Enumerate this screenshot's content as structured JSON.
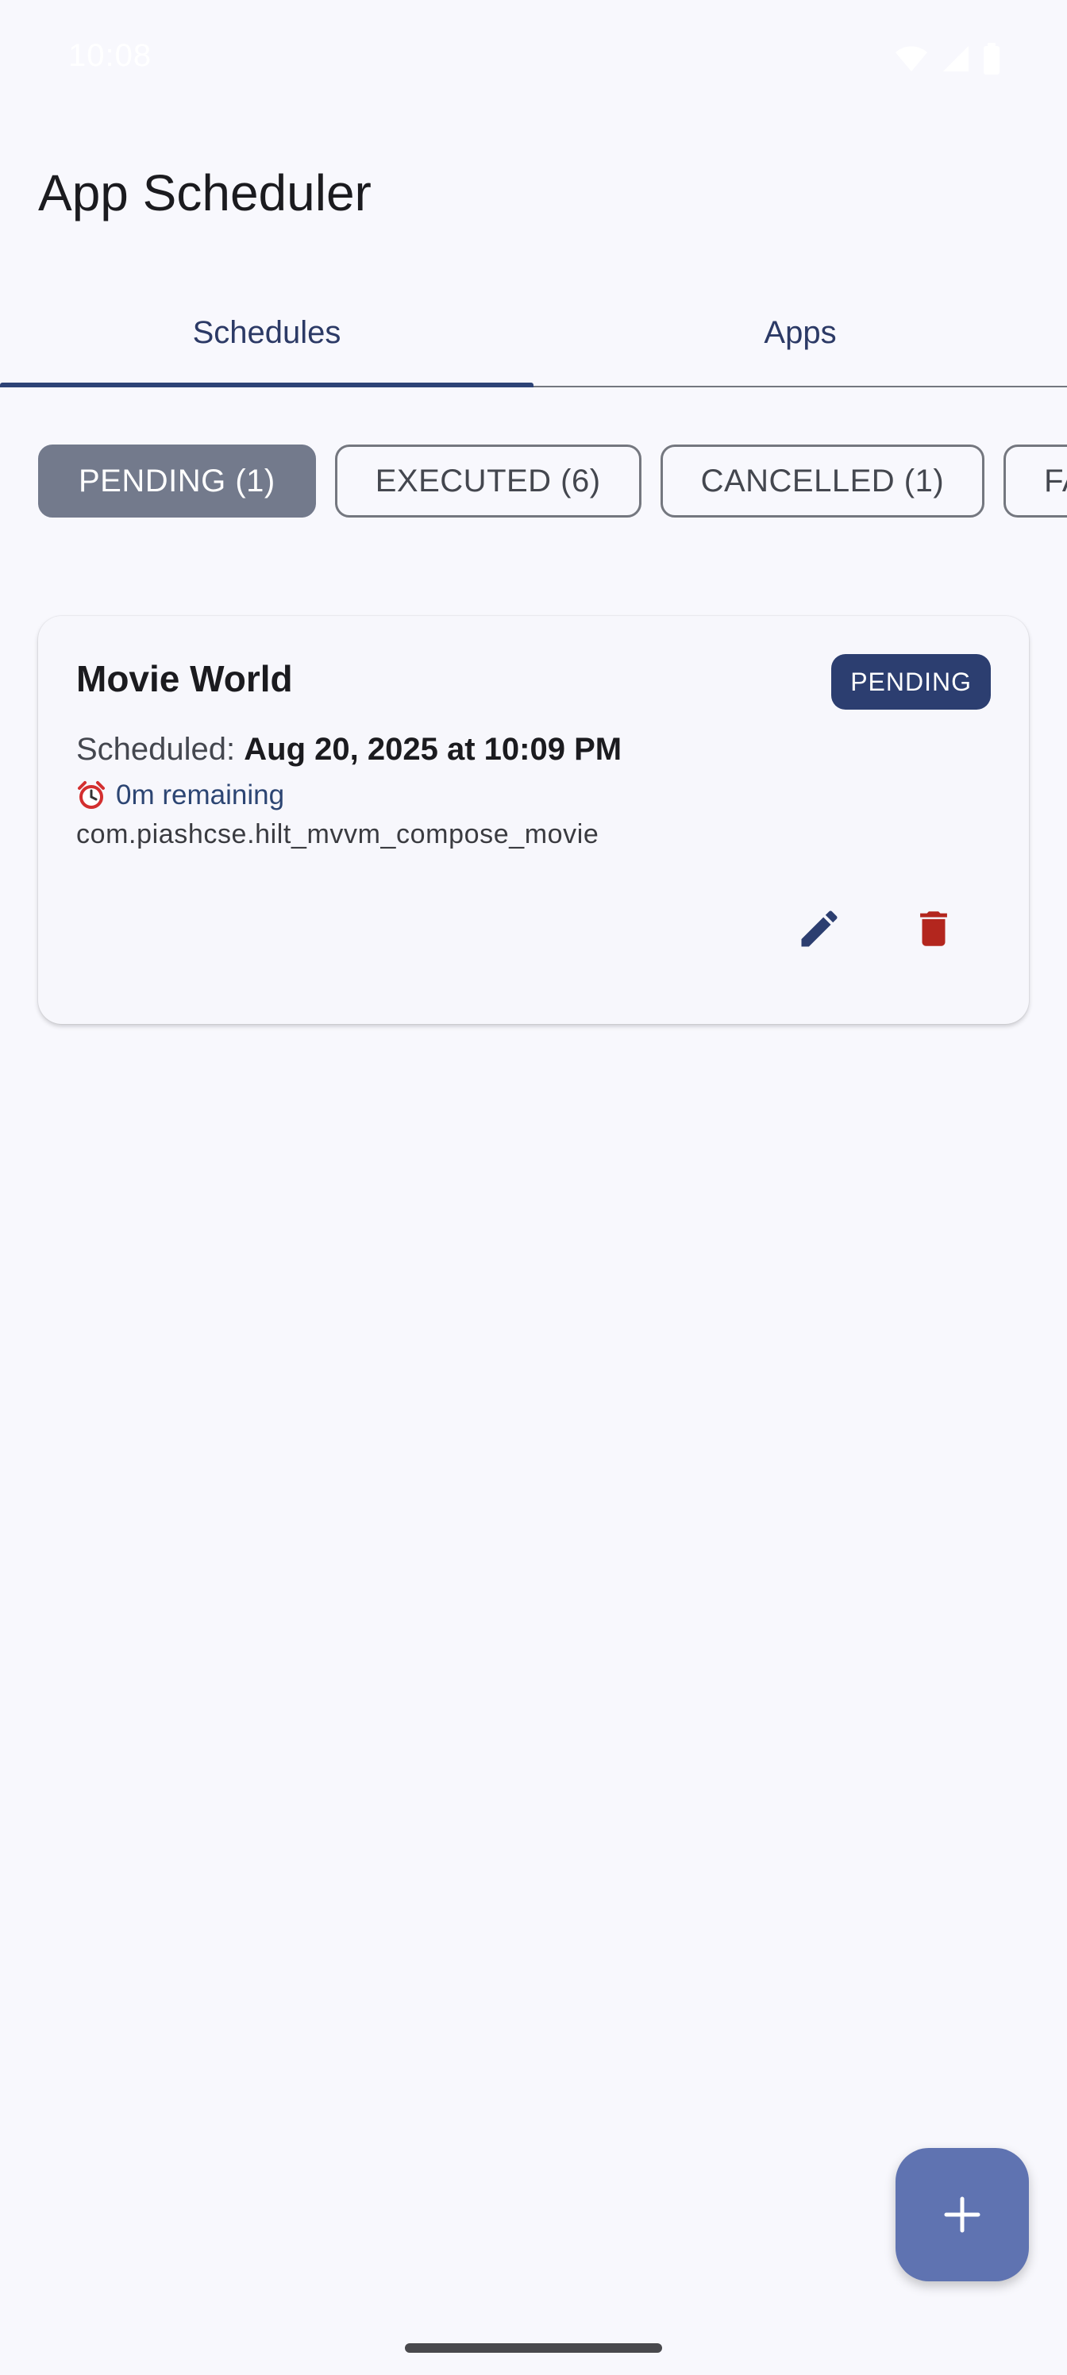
{
  "status_bar": {
    "time": "10:08",
    "icons": [
      "wifi-icon",
      "signal-icon",
      "battery-icon"
    ]
  },
  "app_bar": {
    "title": "App Scheduler"
  },
  "tabs": [
    {
      "label": "Schedules",
      "selected": true
    },
    {
      "label": "Apps",
      "selected": false
    }
  ],
  "filters": [
    {
      "label": "PENDING (1)",
      "selected": true
    },
    {
      "label": "EXECUTED (6)",
      "selected": false
    },
    {
      "label": "CANCELLED (1)",
      "selected": false
    },
    {
      "label": "FAI",
      "selected": false
    }
  ],
  "schedule": {
    "app_name": "Movie World",
    "status": "PENDING",
    "scheduled_prefix": "Scheduled: ",
    "scheduled_value": "Aug 20, 2025 at 10:09 PM",
    "remaining_icon": "alarm-clock-icon",
    "remaining": "0m remaining",
    "package": "com.piashcse.hilt_mvvm_compose_movie",
    "actions": [
      "edit-icon",
      "delete-icon"
    ]
  },
  "fab": {
    "icon": "plus-icon"
  },
  "colors": {
    "primary": "#2c3e70",
    "chip_selected": "#737a8c",
    "fab": "#5f73b1",
    "delete": "#b3261e",
    "background": "#f8f8fd"
  }
}
